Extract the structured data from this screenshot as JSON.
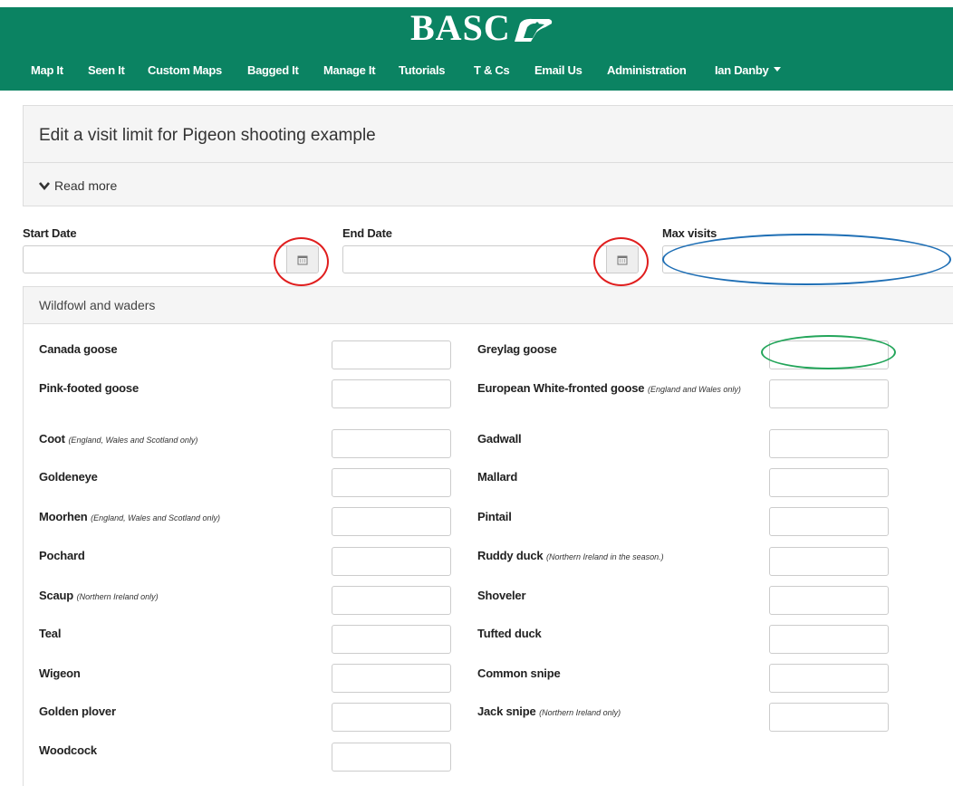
{
  "brand": {
    "logo_text": "BASC",
    "header_color": "#0b8362"
  },
  "nav": {
    "items": [
      "Map It",
      "Seen It",
      "Custom Maps",
      "Bagged It",
      "Manage It",
      "Tutorials",
      "T & Cs",
      "Email Us",
      "Administration"
    ],
    "user": "Ian Danby"
  },
  "page": {
    "title": "Edit a visit limit for Pigeon shooting example",
    "read_more": "Read more"
  },
  "form": {
    "start_date": {
      "label": "Start Date",
      "value": ""
    },
    "end_date": {
      "label": "End Date",
      "value": ""
    },
    "max_visits": {
      "label": "Max visits",
      "value": ""
    }
  },
  "section": {
    "title": "Wildfowl and waders",
    "left": [
      {
        "name": "Canada goose",
        "note": ""
      },
      {
        "name": "Pink-footed goose",
        "note": ""
      },
      {
        "name": "Coot",
        "note": "(England, Wales and Scotland only)"
      },
      {
        "name": "Goldeneye",
        "note": ""
      },
      {
        "name": "Moorhen",
        "note": "(England, Wales and Scotland only)"
      },
      {
        "name": "Pochard",
        "note": ""
      },
      {
        "name": "Scaup",
        "note": "(Northern Ireland only)"
      },
      {
        "name": "Teal",
        "note": ""
      },
      {
        "name": "Wigeon",
        "note": ""
      },
      {
        "name": "Golden plover",
        "note": ""
      },
      {
        "name": "Woodcock",
        "note": ""
      }
    ],
    "right": [
      {
        "name": "Greylag goose",
        "note": ""
      },
      {
        "name": "European White-fronted goose",
        "note": "(England and Wales only)"
      },
      {
        "name": "Gadwall",
        "note": ""
      },
      {
        "name": "Mallard",
        "note": ""
      },
      {
        "name": "Pintail",
        "note": ""
      },
      {
        "name": "Ruddy duck",
        "note": "(Northern Ireland in the season.)"
      },
      {
        "name": "Shoveler",
        "note": ""
      },
      {
        "name": "Tufted duck",
        "note": ""
      },
      {
        "name": "Common snipe",
        "note": ""
      },
      {
        "name": "Jack snipe",
        "note": "(Northern Ireland only)"
      }
    ]
  },
  "annotations": {
    "calendar_ring_color": "#e01e1e",
    "max_visits_ring_color": "#1f6fb5",
    "greylag_ring_color": "#23a55a"
  },
  "icons": {
    "calendar": "calendar-icon",
    "chevron": "chevron-down-icon",
    "logo_mark": "duck-head-logo"
  }
}
